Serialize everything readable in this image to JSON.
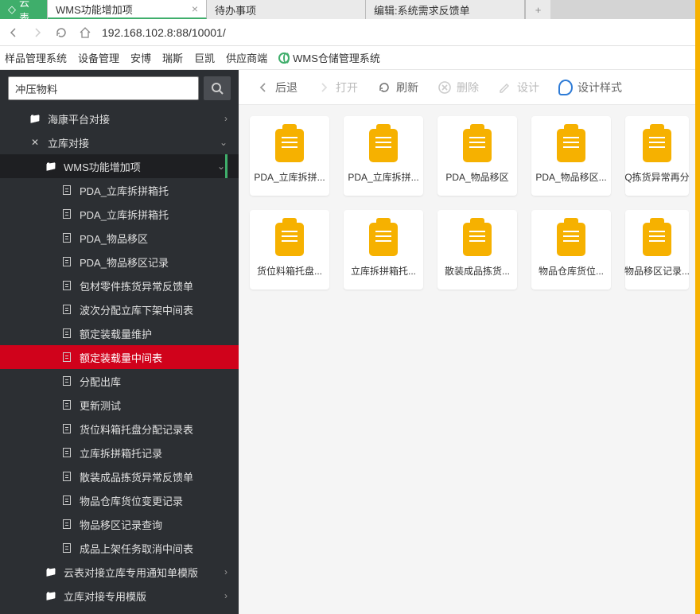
{
  "browserTabs": {
    "cloud": "云表",
    "active": "WMS功能增加项",
    "todo": "待办事项",
    "edit": "编辑:系统需求反馈单"
  },
  "url": "192.168.102.8:88/10001/",
  "topMenu": {
    "items": [
      "样品管理系统",
      "设备管理",
      "安博",
      "瑞斯",
      "巨凯",
      "供应商端"
    ],
    "wms": "WMS仓储管理系统"
  },
  "search": {
    "value": "冲压物料"
  },
  "tree": {
    "hk": "海康平台对接",
    "lk": "立库对接",
    "wms": "WMS功能增加项",
    "items": [
      "PDA_立库拆拼箱托",
      "PDA_立库拆拼箱托",
      "PDA_物品移区",
      "PDA_物品移区记录",
      "包材零件拣货异常反馈单",
      "波次分配立库下架中间表",
      "额定装载量维护",
      "额定装载量中间表",
      "分配出库",
      "更新测试",
      "货位料箱托盘分配记录表",
      "立库拆拼箱托记录",
      "散装成品拣货异常反馈单",
      "物品仓库货位变更记录",
      "物品移区记录查询",
      "成品上架任务取消中间表"
    ],
    "tpl1": "云表对接立库专用通知单模版",
    "tpl2": "立库对接专用模版"
  },
  "toolbar": {
    "back": "后退",
    "open": "打开",
    "refresh": "刷新",
    "delete": "删除",
    "design": "设计",
    "style": "设计样式"
  },
  "cards": [
    "PDA_立库拆拼...",
    "PDA_立库拆拼...",
    "PDA_物品移区",
    "PDA_物品移区...",
    "Q拣货异常再分",
    "货位料箱托盘...",
    "立库拆拼箱托...",
    "散装成品拣货...",
    "物品仓库货位...",
    "物品移区记录..."
  ]
}
